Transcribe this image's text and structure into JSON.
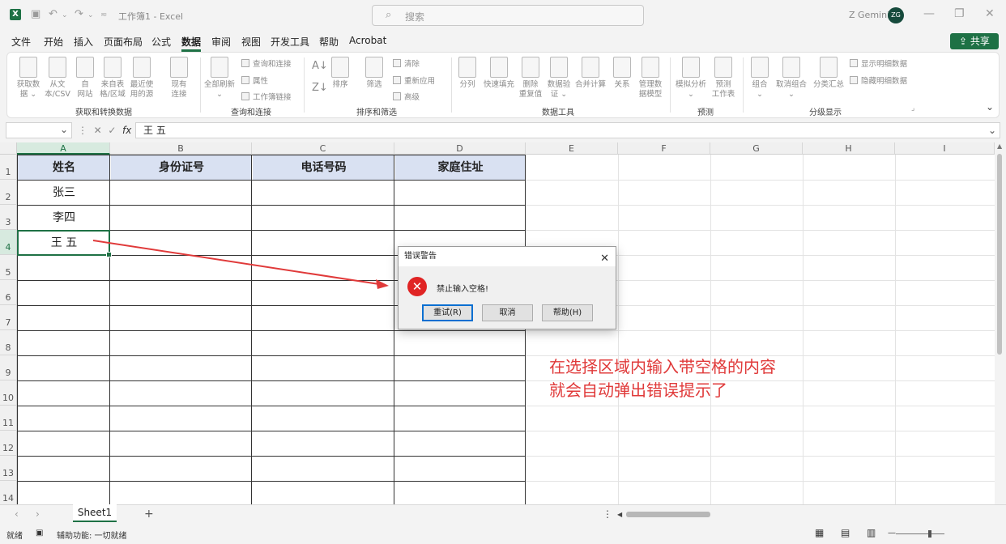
{
  "title_bar": {
    "doc_title": "工作簿1 - Excel",
    "search_placeholder": "搜索",
    "user_name": "Z Gemini",
    "user_initials": "ZG",
    "logo_letter": "X"
  },
  "menu": [
    "文件",
    "开始",
    "插入",
    "页面布局",
    "公式",
    "数据",
    "审阅",
    "视图",
    "开发工具",
    "帮助",
    "Acrobat"
  ],
  "active_menu": "数据",
  "share_label": "共享",
  "ribbon": {
    "groups": [
      "获取和转换数据",
      "查询和连接",
      "排序和筛选",
      "数据工具",
      "预测",
      "分级显示"
    ],
    "get_data": [
      "获取数\n据 ⌄",
      "从文\n本/CSV",
      "自\n网站",
      "来自表\n格/区域",
      "最近使\n用的源",
      "现有\n连接"
    ],
    "refresh_all": "全部刷新\n⌄",
    "query_links": [
      "查询和连接",
      "属性",
      "工作簿链接"
    ],
    "sort": "排序",
    "filter": "筛选",
    "filter_links": [
      "清除",
      "重新应用",
      "高级"
    ],
    "tools": [
      "分列",
      "快速填充",
      "删除\n重复值",
      "数据验\n证 ⌄",
      "合并计算",
      "关系",
      "管理数\n据模型"
    ],
    "forecast": [
      "模拟分析\n⌄",
      "预测\n工作表"
    ],
    "outline": [
      "组合\n⌄",
      "取消组合\n⌄",
      "分类汇总"
    ],
    "outline_links": [
      "显示明细数据",
      "隐藏明细数据"
    ]
  },
  "formula_bar": {
    "fx": "fx",
    "content": "王 五"
  },
  "columns": [
    "A",
    "B",
    "C",
    "D",
    "E",
    "F",
    "G",
    "H",
    "I"
  ],
  "rows": [
    "1",
    "2",
    "3",
    "4",
    "5",
    "6",
    "7",
    "8",
    "9",
    "10",
    "11",
    "12",
    "13",
    "14"
  ],
  "table": {
    "headers": [
      "姓名",
      "身份证号",
      "电话号码",
      "家庭住址"
    ],
    "names": [
      "张三",
      "李四",
      "王 五"
    ]
  },
  "annotation": [
    "在选择区域内输入带空格的内容",
    "就会自动弹出错误提示了"
  ],
  "dialog": {
    "title": "错误警告",
    "message": "禁止输入空格!",
    "buttons": [
      "重试(R)",
      "取消",
      "帮助(H)"
    ]
  },
  "sheet_tab": "Sheet1",
  "status": {
    "ready": "就绪",
    "accessibility": "辅助功能: 一切就绪"
  },
  "colors": {
    "accent": "#1e7145",
    "header_fill": "#d9e1f2",
    "annotation": "#e03a3a",
    "error": "#e02424"
  }
}
